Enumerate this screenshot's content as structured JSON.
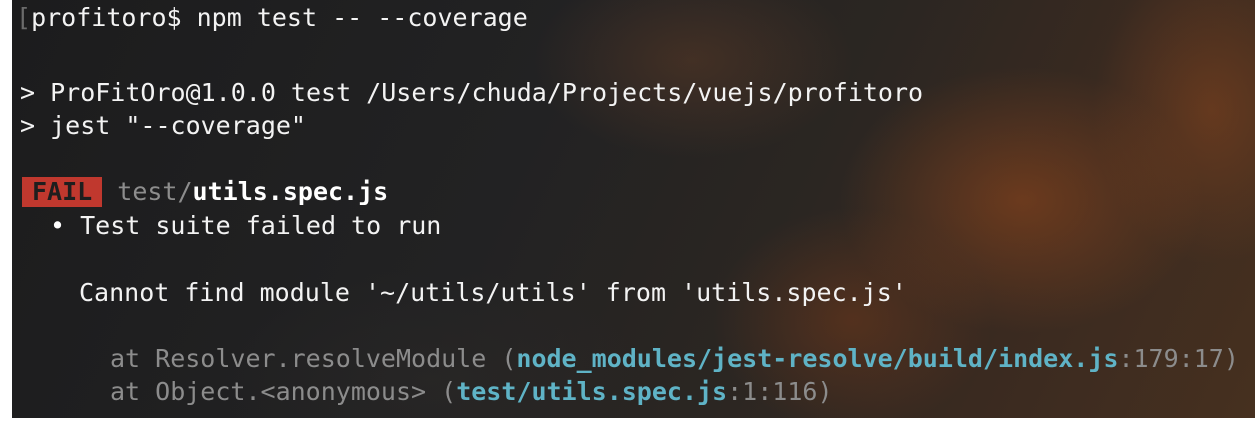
{
  "terminal": {
    "prompt": "profitoro$ npm test -- --coverage",
    "script_header": "> ProFitOro@1.0.0 test /Users/chuda/Projects/vuejs/profitoro",
    "script_cmd": "> jest \"--coverage\"",
    "fail_badge": "FAIL",
    "fail_dir": "test/",
    "fail_file": "utils.spec.js",
    "bullet": "•",
    "error_title": "Test suite failed to run",
    "error_message": "Cannot find module '~/utils/utils' from 'utils.spec.js'",
    "stack": [
      {
        "prefix": "at Resolver.resolveModule (",
        "path": "node_modules/jest-resolve/build/index.js",
        "location": ":179:17",
        "suffix": ")"
      },
      {
        "prefix": "at Object.<anonymous> (",
        "path": "test/utils.spec.js",
        "location": ":1:116",
        "suffix": ")"
      }
    ]
  },
  "colors": {
    "fail_badge_bg": "#c0382e",
    "path_highlight": "#5fb3c6",
    "stack_gray": "#8c8c8c"
  }
}
